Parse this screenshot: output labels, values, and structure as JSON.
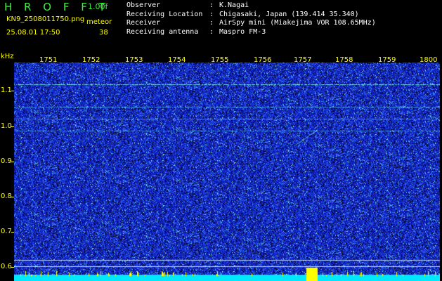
{
  "header": {
    "app_title": "H R O F F T",
    "version": "1.00f",
    "filename": "KN9_2508011750.png",
    "mode": "meteor",
    "datetime": "25.08.01 17:50",
    "count": "38"
  },
  "station": [
    {
      "key": "Observer",
      "sep": ":",
      "value": "K.Nagai"
    },
    {
      "key": "Receiving Location",
      "sep": ":",
      "value": "Chigasaki, Japan (139.414 35.340)"
    },
    {
      "key": "Receiver",
      "sep": ":",
      "value": "AirSpy mini (Miakejima VOR 108.65MHz)"
    },
    {
      "key": "Receiving antenna",
      "sep": ":",
      "value": "Maspro FM-3"
    }
  ],
  "axis": {
    "y_unit": "kHz",
    "x_ticks": [
      "1751",
      "1752",
      "1753",
      "1754",
      "1755",
      "1756",
      "1757",
      "1758",
      "1759",
      "1800"
    ],
    "y_ticks": [
      "1.1",
      "1.0",
      "0.9",
      "0.8",
      "0.7",
      "0.6"
    ]
  },
  "colors": {
    "background": "#000000",
    "spectrum": "#1020c8",
    "text_green": "#3cf03c",
    "text_yellow": "#ffff00",
    "baseline": "#00e8ff"
  }
}
